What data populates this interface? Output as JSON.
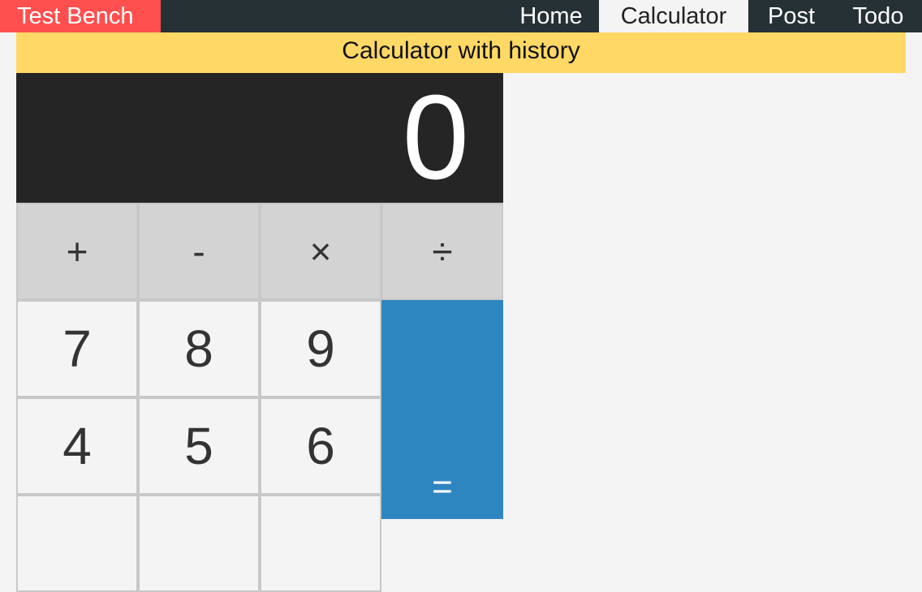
{
  "header": {
    "brand": "Test Bench",
    "nav": [
      "Home",
      "Calculator",
      "Post",
      "Todo"
    ],
    "active": "Calculator"
  },
  "banner": {
    "title": "Calculator with history"
  },
  "display": {
    "value": "0"
  },
  "keypad": {
    "operators": [
      "+",
      "-",
      "×",
      "÷"
    ],
    "rows": [
      [
        "7",
        "8",
        "9"
      ],
      [
        "4",
        "5",
        "6"
      ],
      [
        "",
        "",
        ""
      ]
    ],
    "equals": "="
  },
  "colors": {
    "brand_bg": "#ff4f4f",
    "topbar_bg": "#263135",
    "banner_bg": "#ffd866",
    "display_bg": "#252525",
    "equals_bg": "#2e86c1"
  }
}
